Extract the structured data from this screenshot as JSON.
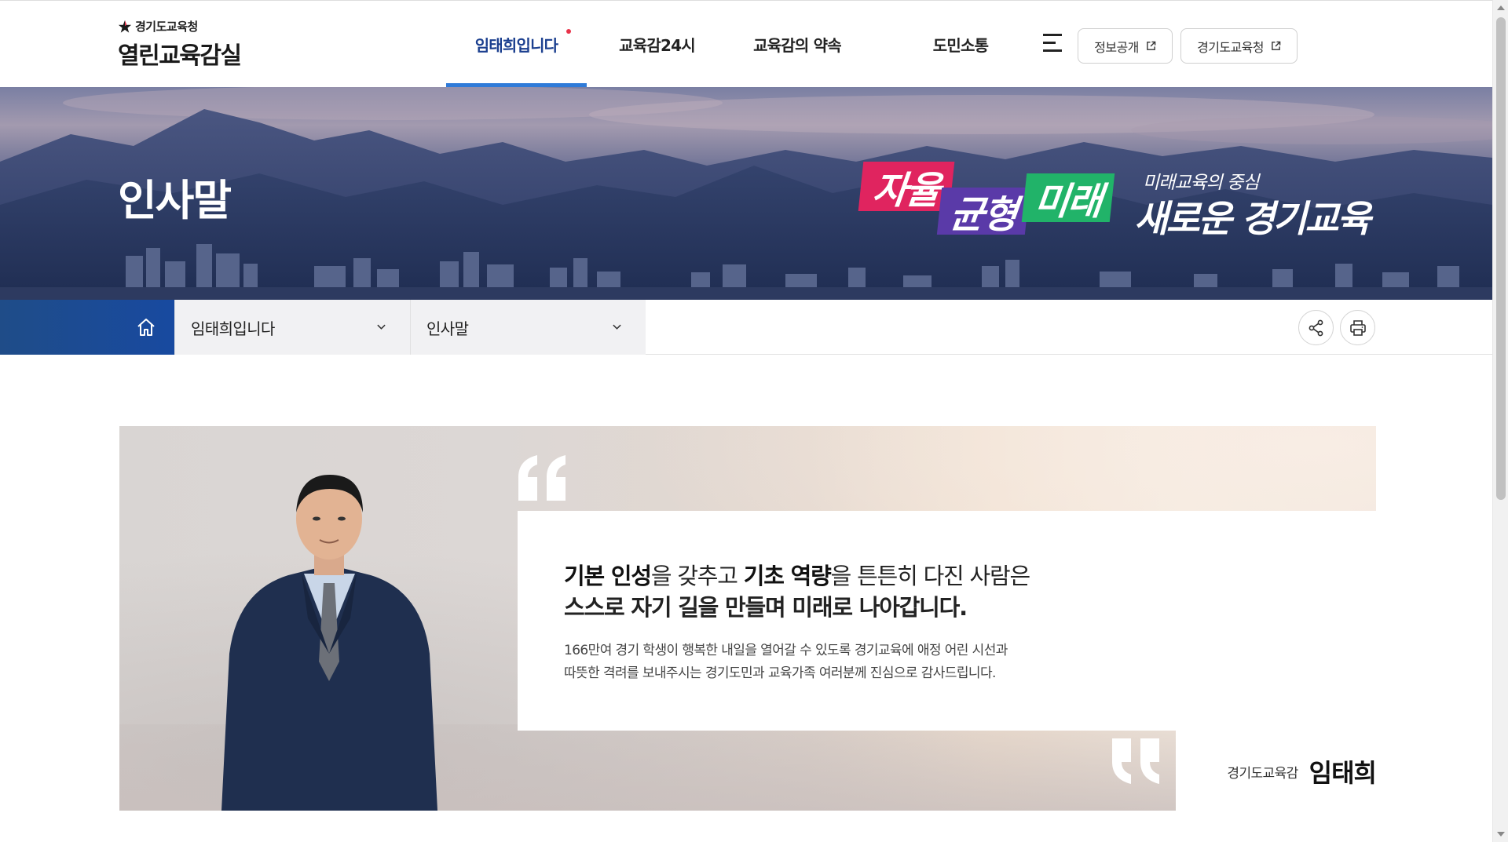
{
  "header": {
    "logo_small": "경기도교육청",
    "logo_big": "열린교육감실",
    "nav": [
      {
        "label": "임태희입니다"
      },
      {
        "label": "교육감24시"
      },
      {
        "label": "교육감의 약속"
      },
      {
        "label": "도민소통"
      }
    ],
    "util_buttons": [
      {
        "label": "정보공개"
      },
      {
        "label": "경기도교육청"
      }
    ]
  },
  "hero": {
    "title": "인사말",
    "slogan_words": [
      "자율",
      "균형",
      "미래"
    ],
    "slogan_sub": "미래교육의 중심",
    "slogan_main": "새로운 경기교육"
  },
  "location": {
    "depth1": "임태희입니다",
    "depth2": "인사말"
  },
  "greeting": {
    "headline_1_a": "기본 인성",
    "headline_1_b": "을 갖추고 ",
    "headline_1_c": "기초 역량",
    "headline_1_d": "을 튼튼히 다진 사람은",
    "headline_2": "스스로 자기 길을 만들며 미래로 나아갑니다.",
    "body_1": "166만여 경기 학생이 행복한 내일을 열어갈 수 있도록 경기교육에 애정 어린 시선과",
    "body_2": "따뜻한 격려를 보내주시는 경기도민과 교육가족 여러분께 진심으로 감사드립니다.",
    "signature_role": "경기도교육감",
    "signature_name": "임태희"
  },
  "colors": {
    "nav_active": "#2f7bd9",
    "home_bg": "#1f4c88",
    "slogan_red": "#e0245f",
    "slogan_purple": "#5a3aa8",
    "slogan_green": "#21b369"
  },
  "icons": [
    "star-logo-icon",
    "menu-icon",
    "external-link-icon",
    "home-icon",
    "chevron-down-icon",
    "share-icon",
    "print-icon"
  ]
}
